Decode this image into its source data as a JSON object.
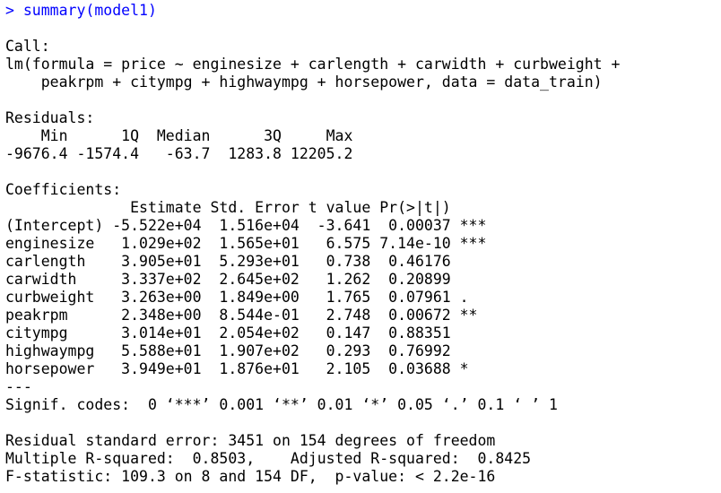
{
  "console": {
    "command_line": "> summary(model1)",
    "lines": [
      "",
      "Call:",
      "lm(formula = price ~ enginesize + carlength + carwidth + curbweight +",
      "    peakrpm + citympg + highwaympg + horsepower, data = data_train)",
      "",
      "Residuals:",
      "    Min      1Q  Median      3Q     Max ",
      "-9676.4 -1574.4   -63.7  1283.8 12205.2 ",
      "",
      "Coefficients:",
      "              Estimate Std. Error t value Pr(>|t|)    ",
      "(Intercept) -5.522e+04  1.516e+04  -3.641  0.00037 ***",
      "enginesize   1.029e+02  1.565e+01   6.575 7.14e-10 ***",
      "carlength    3.905e+01  5.293e+01   0.738  0.46176    ",
      "carwidth     3.337e+02  2.645e+02   1.262  0.20899    ",
      "curbweight   3.263e+00  1.849e+00   1.765  0.07961 .  ",
      "peakrpm      2.348e+00  8.544e-01   2.748  0.00672 ** ",
      "citympg      3.014e+01  2.054e+02   0.147  0.88351    ",
      "highwaympg   5.588e+01  1.907e+02   0.293  0.76992    ",
      "horsepower   3.949e+01  1.876e+01   2.105  0.03688 *  ",
      "---",
      "Signif. codes:  0 ‘***’ 0.001 ‘**’ 0.01 ‘*’ 0.05 ‘.’ 0.1 ‘ ’ 1",
      "",
      "Residual standard error: 3451 on 154 degrees of freedom",
      "Multiple R-squared:  0.8503,\tAdjusted R-squared:  0.8425 ",
      "F-statistic: 109.3 on 8 and 154 DF,  p-value: < 2.2e-16"
    ]
  },
  "colors": {
    "command": "#0000ff",
    "output": "#000000",
    "background": "#ffffff"
  }
}
